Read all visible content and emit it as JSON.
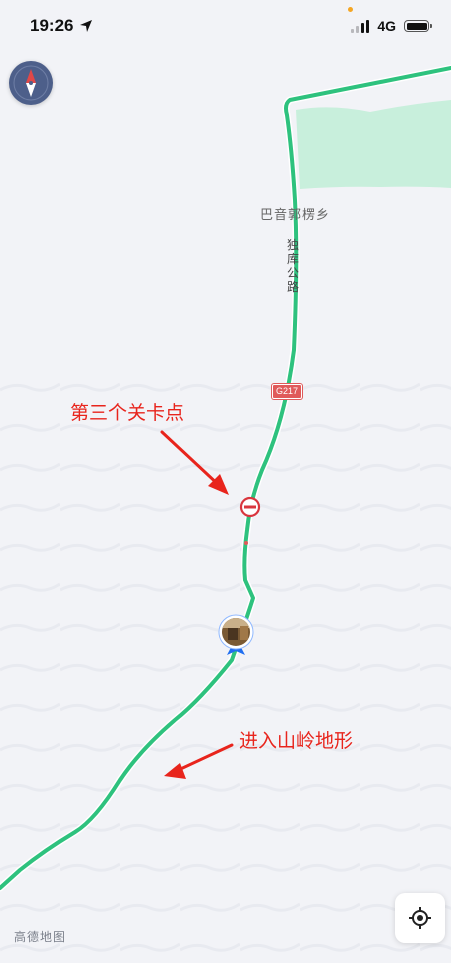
{
  "status_bar": {
    "time": "19:26",
    "network": "4G",
    "signal_bars": 4,
    "signal_active": 2,
    "location_active": true
  },
  "map": {
    "place_label": "巴音郭楞乡",
    "road_name": "独库公路",
    "road_shield": "G217",
    "route_color": "#2ec27e",
    "vegetation_color": "#c8efdc",
    "background_color": "#f2f3f7",
    "marker_icons": [
      "no-entry-icon",
      "photo-location-marker"
    ]
  },
  "annotations": {
    "checkpoint": "第三个关卡点",
    "mountain": "进入山岭地形",
    "color": "#e8241c"
  },
  "watermark": "高德地图",
  "controls": {
    "compass": "compass-icon",
    "locate": "locate-icon"
  }
}
